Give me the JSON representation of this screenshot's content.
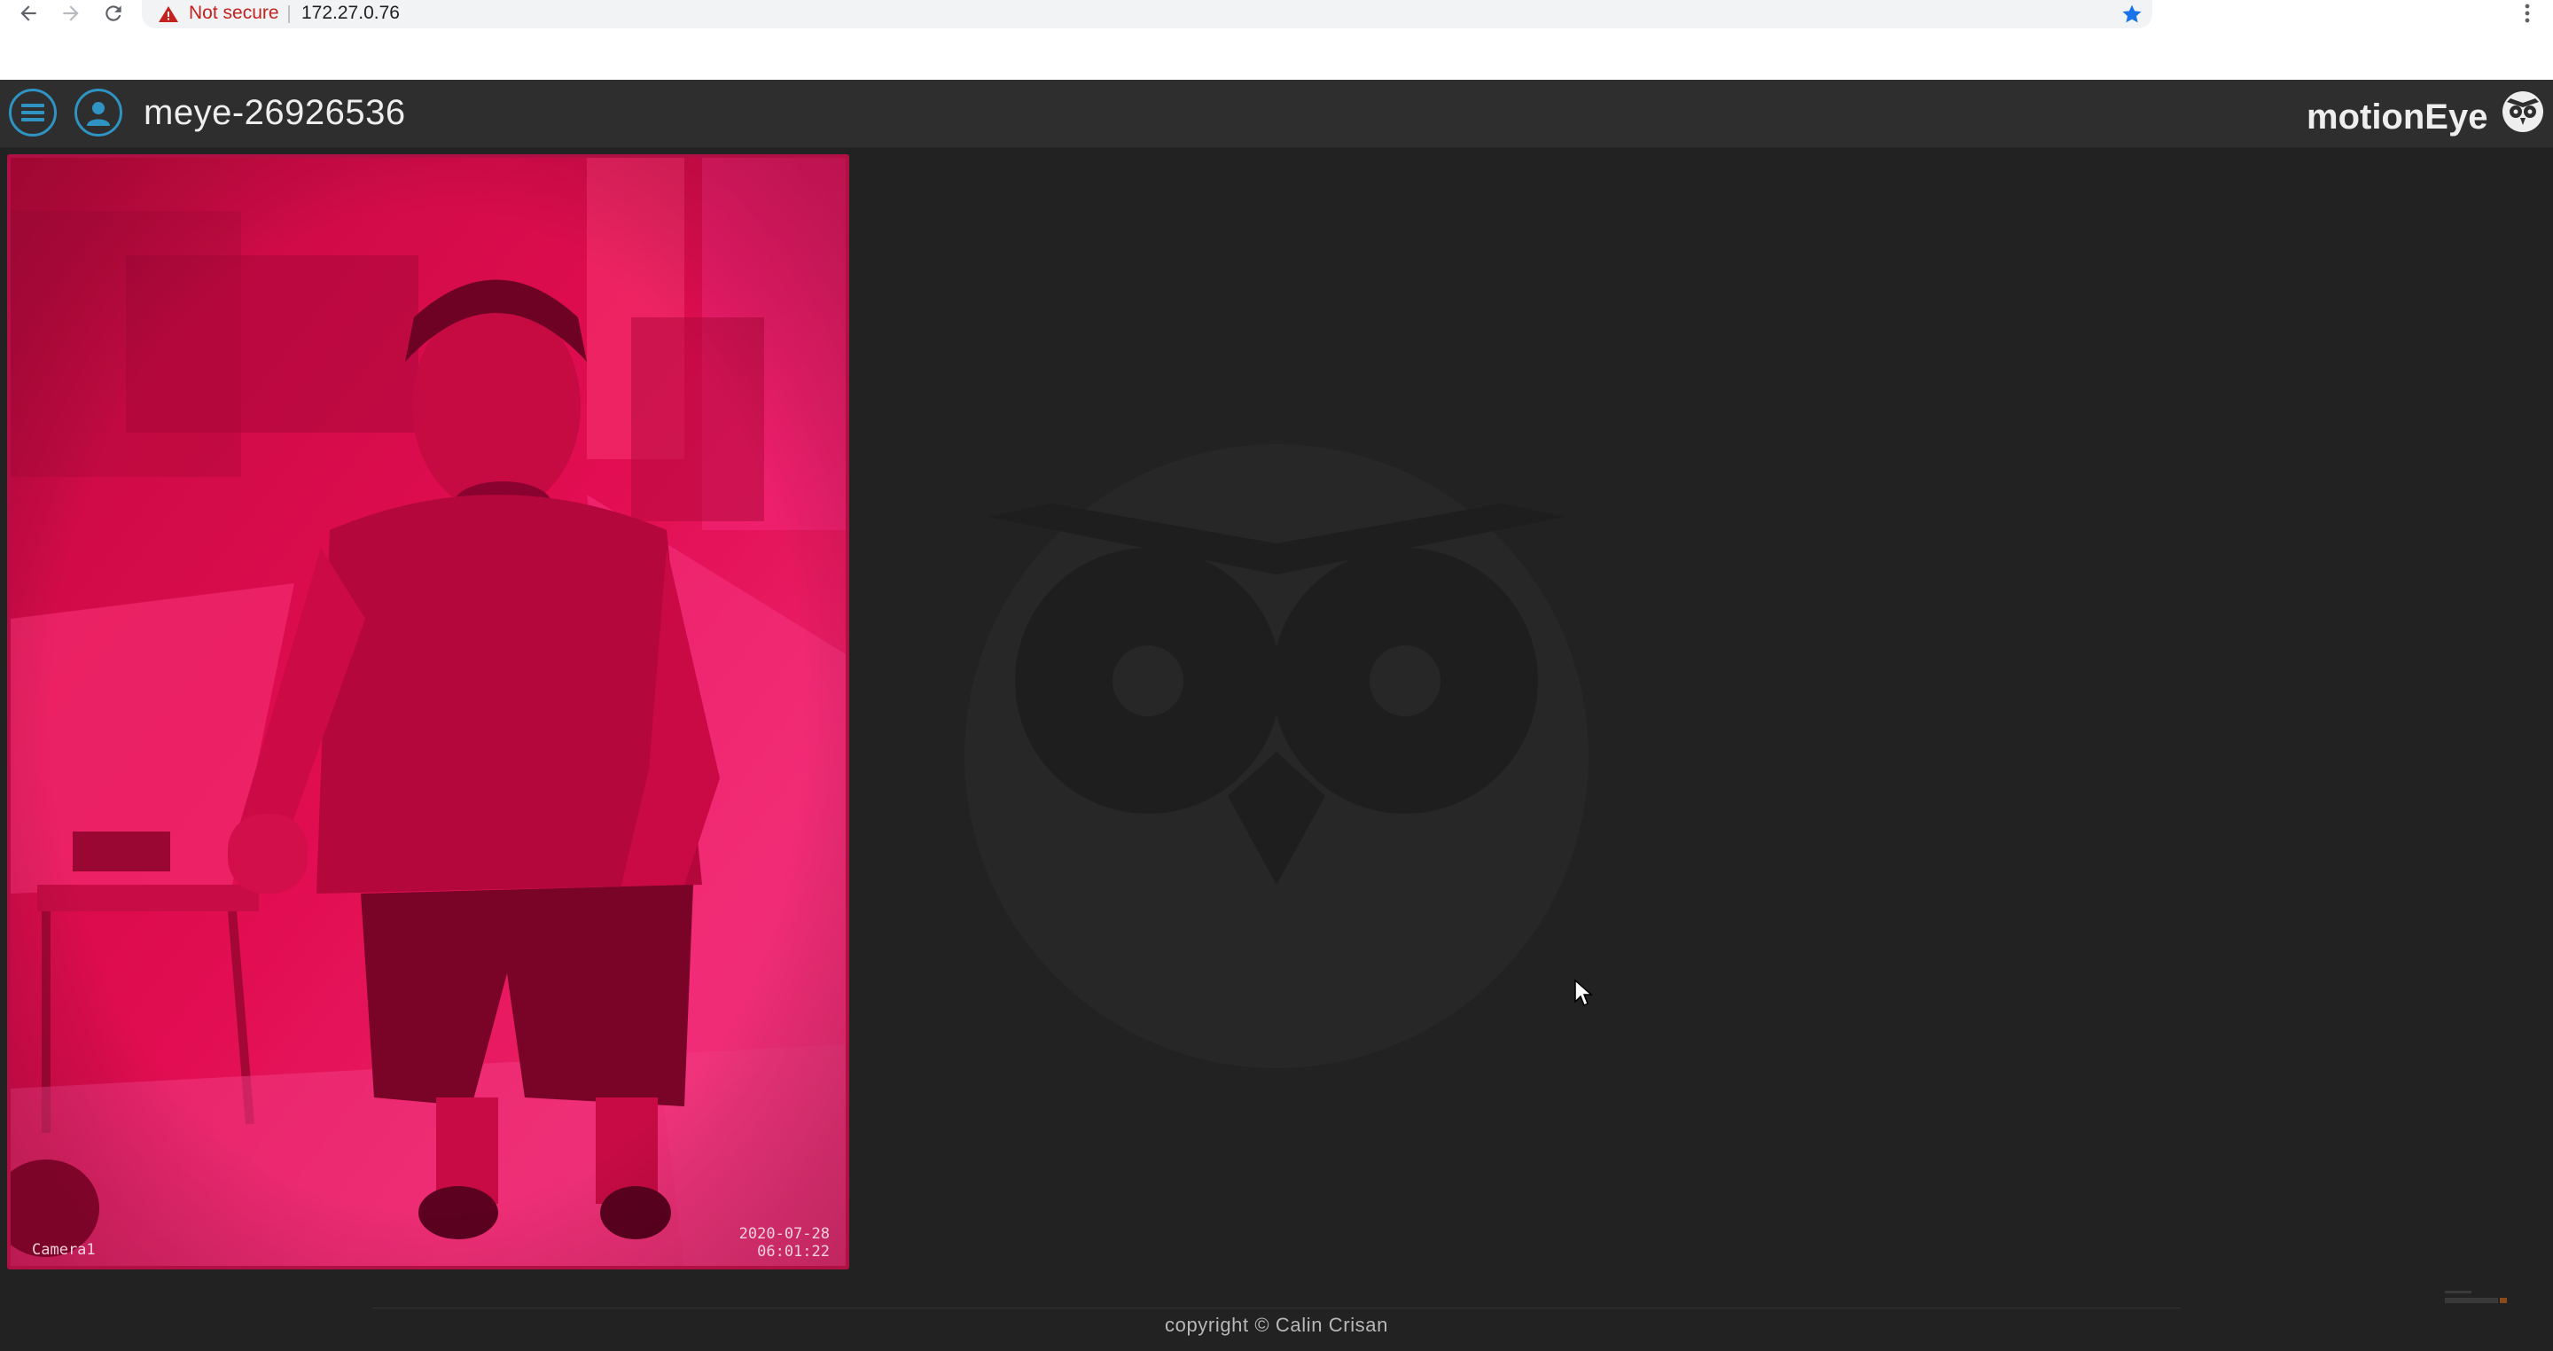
{
  "browser": {
    "security_label": "Not secure",
    "url": "172.27.0.76",
    "icons": [
      "back-arrow-icon",
      "forward-arrow-icon",
      "reload-icon",
      "warning-triangle-icon",
      "bookmark-star-icon",
      "more-vert-icon"
    ]
  },
  "header": {
    "host_name": "meye-26926536",
    "brand": "motionEye",
    "icons": [
      "menu-icon",
      "user-icon",
      "owl-logo-icon"
    ],
    "accent_color": "#2f93c4"
  },
  "camera": {
    "name": "Camera1",
    "date": "2020-07-28",
    "time": "06:01:22",
    "frame_color": "#b01043"
  },
  "footer": {
    "copyright": "copyright © Calin Crisan"
  }
}
